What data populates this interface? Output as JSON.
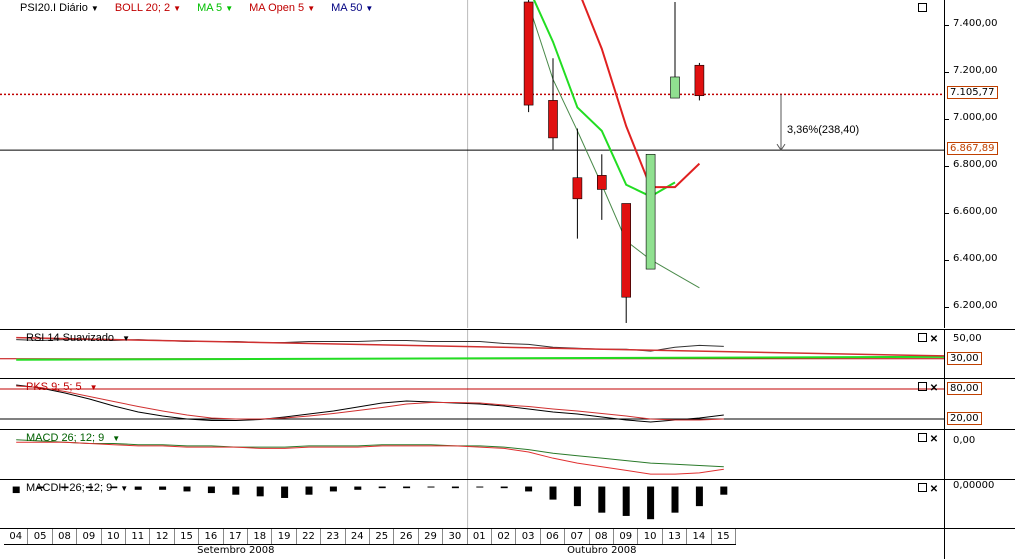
{
  "colors": {
    "up_candle": "#90e090",
    "down_candle": "#e01010",
    "ma5": "#22dd22",
    "ma_open": "#e02020",
    "ma50": "#4a8a4a",
    "price_line": "#c00000",
    "rsi_line": "#333333",
    "rsi_signal_green": "#22dd22",
    "rsi_signal_red": "#d03030",
    "pks_k": "#000000",
    "pks_d": "#d03030",
    "macd": "#2a7a2a",
    "macd_signal": "#e03030",
    "histogram": "#000000",
    "badge_border": "#c04000"
  },
  "price_panel": {
    "legend": [
      {
        "label": "PSI20.I Diário",
        "color": "#000000",
        "icon": "menu-icon"
      },
      {
        "label": "BOLL 20; 2",
        "color": "#c00000",
        "icon": "triangle-down-icon"
      },
      {
        "label": "MA 5",
        "color": "#00c000",
        "icon": "triangle-down-icon"
      },
      {
        "label": "MA Open  5",
        "color": "#c00000",
        "icon": "triangle-down-icon"
      },
      {
        "label": "MA 50",
        "color": "#000080",
        "icon": "triangle-down-icon"
      }
    ],
    "y_ticks": [
      "7.400,00",
      "7.200,00",
      "7.000,00",
      "6.800,00",
      "6.600,00",
      "6.400,00",
      "6.200,00"
    ],
    "y_tick_values": [
      7400,
      7200,
      7000,
      6800,
      6600,
      6400,
      6200
    ],
    "current_price_badge": "7.105,77",
    "current_price": 7105.77,
    "reference_badge": "6.867,89",
    "reference_price": 6867.89,
    "change_annotation": "3,36%(238,40)"
  },
  "rsi_panel": {
    "label": "RSI 14 Suavizado",
    "y_ticks": [
      "50,00",
      "30,00"
    ],
    "y_tick_values": [
      50,
      30
    ]
  },
  "pks_panel": {
    "label": "PKS 9; 5; 5",
    "y_ticks": [
      "80,00",
      "20,00"
    ],
    "y_tick_values": [
      80,
      20
    ]
  },
  "macd_panel": {
    "label": "MACD 26; 12; 9",
    "y_ticks": [
      "0,00"
    ],
    "y_tick_values": [
      0
    ]
  },
  "macdh_panel": {
    "label": "MACDH 26; 12; 9",
    "y_ticks": [
      "0,00000"
    ],
    "y_tick_values": [
      0
    ]
  },
  "x_axis": {
    "days": [
      "04",
      "05",
      "08",
      "09",
      "10",
      "11",
      "12",
      "15",
      "16",
      "17",
      "18",
      "19",
      "22",
      "23",
      "24",
      "25",
      "26",
      "29",
      "30",
      "01",
      "02",
      "03",
      "06",
      "07",
      "08",
      "09",
      "10",
      "13",
      "14",
      "15"
    ],
    "months": [
      {
        "label": "Setembro 2008",
        "start_index": 0,
        "end_index": 18
      },
      {
        "label": "Outubro 2008",
        "start_index": 19,
        "end_index": 29
      }
    ]
  },
  "chart_data": {
    "type": "candlestick",
    "title": "PSI20.I Diário",
    "ylim": [
      6100,
      7500
    ],
    "candles": [
      {
        "date": "03",
        "open": 7500,
        "high": 7540,
        "low": 7030,
        "close": 7060
      },
      {
        "date": "06",
        "open": 7080,
        "high": 7260,
        "low": 6870,
        "close": 6920
      },
      {
        "date": "07",
        "open": 6750,
        "high": 6960,
        "low": 6490,
        "close": 6660
      },
      {
        "date": "08",
        "open": 6760,
        "high": 6850,
        "low": 6570,
        "close": 6700
      },
      {
        "date": "09",
        "open": 6640,
        "high": 6640,
        "low": 6130,
        "close": 6240
      },
      {
        "date": "10",
        "open": 6360,
        "high": 6850,
        "low": 6360,
        "close": 6850
      },
      {
        "date": "13",
        "open": 7090,
        "high": 7500,
        "low": 7090,
        "close": 7180
      },
      {
        "date": "14",
        "open": 7230,
        "high": 7240,
        "low": 7080,
        "close": 7100
      }
    ],
    "series": [
      {
        "name": "MA 5",
        "points": [
          {
            "date": "03",
            "value": 7560
          },
          {
            "date": "06",
            "value": 7330
          },
          {
            "date": "07",
            "value": 7050
          },
          {
            "date": "08",
            "value": 6950
          },
          {
            "date": "09",
            "value": 6720
          },
          {
            "date": "10",
            "value": 6670
          },
          {
            "date": "13",
            "value": 6730
          }
        ]
      },
      {
        "name": "MA Open 5",
        "points": [
          {
            "date": "07",
            "value": 7560
          },
          {
            "date": "08",
            "value": 7300
          },
          {
            "date": "09",
            "value": 6970
          },
          {
            "date": "10",
            "value": 6710
          },
          {
            "date": "13",
            "value": 6710
          },
          {
            "date": "14",
            "value": 6810
          }
        ]
      },
      {
        "name": "MA 50",
        "points": [
          {
            "date": "03",
            "value": 7490
          },
          {
            "date": "06",
            "value": 7170
          },
          {
            "date": "07",
            "value": 6950
          },
          {
            "date": "08",
            "value": 6720
          },
          {
            "date": "09",
            "value": 6480
          },
          {
            "date": "10",
            "value": 6400
          },
          {
            "date": "13",
            "value": 6340
          },
          {
            "date": "14",
            "value": 6280
          }
        ]
      }
    ],
    "rsi": {
      "ylim": [
        10,
        60
      ],
      "values": [
        50,
        49,
        50,
        50,
        49,
        50,
        49,
        48,
        48,
        48,
        47,
        47,
        48,
        48,
        48,
        49,
        49,
        48,
        48,
        48,
        46,
        45,
        42,
        41,
        40,
        40,
        38,
        42,
        44,
        43
      ],
      "signal_green": [
        {
          "i": 0,
          "v": 29
        },
        {
          "i": 29,
          "v": 32
        }
      ],
      "signal_red": [
        {
          "i": 0,
          "v": 52
        },
        {
          "i": 29,
          "v": 33
        }
      ]
    },
    "pks": {
      "ylim": [
        0,
        100
      ],
      "k": [
        88,
        82,
        72,
        60,
        46,
        34,
        26,
        20,
        17,
        17,
        19,
        24,
        30,
        36,
        44,
        52,
        56,
        54,
        52,
        50,
        46,
        40,
        34,
        30,
        24,
        18,
        14,
        18,
        22,
        28
      ],
      "d": [
        86,
        83,
        75,
        65,
        55,
        45,
        36,
        28,
        22,
        20,
        20,
        22,
        26,
        31,
        37,
        43,
        50,
        53,
        53,
        52,
        48,
        45,
        40,
        36,
        31,
        26,
        20,
        18,
        18,
        20
      ]
    },
    "macd": {
      "ylim": [
        -30,
        10
      ],
      "macd": [
        2,
        1,
        0,
        -1,
        -1,
        -2,
        -2,
        -3,
        -3,
        -4,
        -4,
        -4,
        -3,
        -3,
        -3,
        -2,
        -2,
        -2,
        -3,
        -3,
        -4,
        -6,
        -9,
        -11,
        -13,
        -15,
        -17,
        -18,
        -19,
        -20
      ],
      "signal": [
        0,
        0,
        0,
        -1,
        -2,
        -3,
        -3,
        -4,
        -4,
        -4,
        -5,
        -5,
        -4,
        -4,
        -4,
        -3,
        -3,
        -3,
        -3,
        -4,
        -5,
        -8,
        -13,
        -17,
        -20,
        -23,
        -26,
        -26,
        -25,
        -22
      ]
    },
    "macdh": {
      "ylim": [
        -26,
        4
      ],
      "values": [
        -4,
        -1,
        -1,
        -1,
        -1,
        -2,
        -2,
        -3,
        -4,
        -5,
        -6,
        -7,
        -5,
        -3,
        -2,
        -1,
        -1,
        0,
        -1,
        0,
        -1,
        -3,
        -8,
        -12,
        -16,
        -18,
        -20,
        -16,
        -12,
        -5
      ]
    }
  }
}
